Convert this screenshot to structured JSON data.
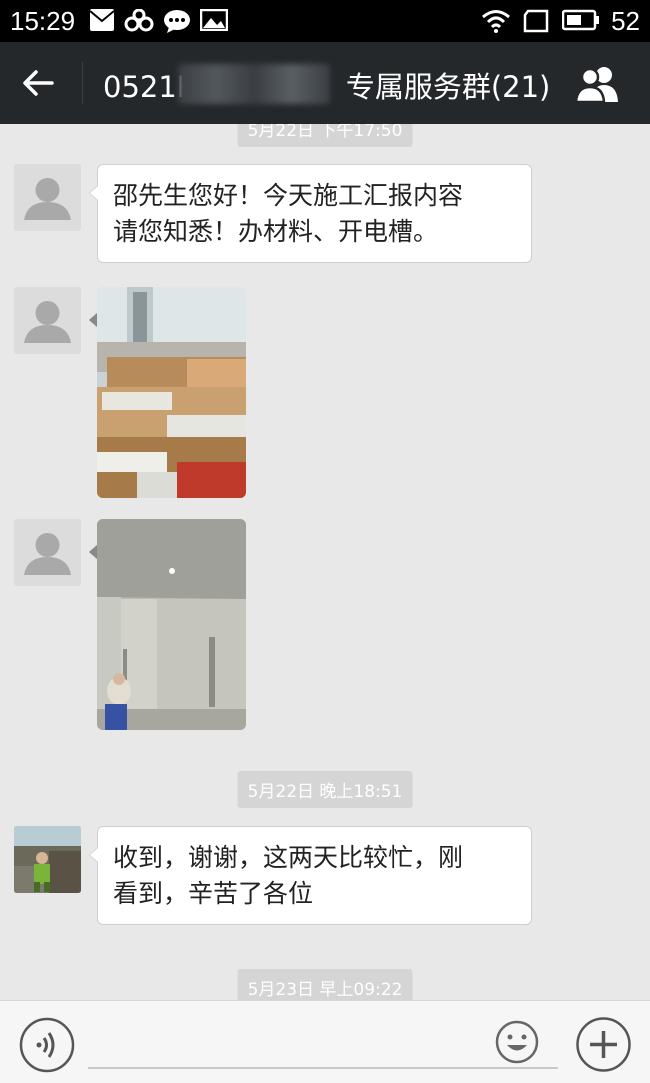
{
  "status_bar": {
    "time": "15:29",
    "battery": "52",
    "icons": [
      "mail-icon",
      "link-icon",
      "chat-bubble-icon",
      "image-icon",
      "wifi-icon",
      "screen-icon",
      "battery-icon"
    ]
  },
  "header": {
    "title_prefix": "0521K",
    "title_suffix": "专属服务群(21)",
    "back_icon": "back-arrow-icon",
    "group_icon": "group-members-icon"
  },
  "messages": [
    {
      "type": "time",
      "text": "5月22日 下午17:50"
    },
    {
      "type": "text",
      "sender": "contact",
      "lines": [
        "邵先生您好！今天施工汇报内容",
        "请您知悉！办材料、开电槽。"
      ]
    },
    {
      "type": "image",
      "sender": "contact",
      "description_icon": "photo-materials-icon"
    },
    {
      "type": "image",
      "sender": "contact",
      "description_icon": "photo-room-icon"
    },
    {
      "type": "time",
      "text": "5月22日 晚上18:51"
    },
    {
      "type": "text",
      "sender": "customer",
      "lines": [
        "收到，谢谢，这两天比较忙，刚",
        "看到，辛苦了各位"
      ]
    },
    {
      "type": "time",
      "text": "5月23日 早上09:22"
    }
  ],
  "input_bar": {
    "placeholder": "",
    "voice_icon": "voice-icon",
    "emoji_icon": "emoji-icon",
    "plus_icon": "plus-icon"
  },
  "colors": {
    "status_bar": "#000000",
    "title_bar": "#25282b",
    "chat_bg": "#e8e8e8",
    "bubble": "#ffffff",
    "time_pill": "#d5d5d5"
  }
}
